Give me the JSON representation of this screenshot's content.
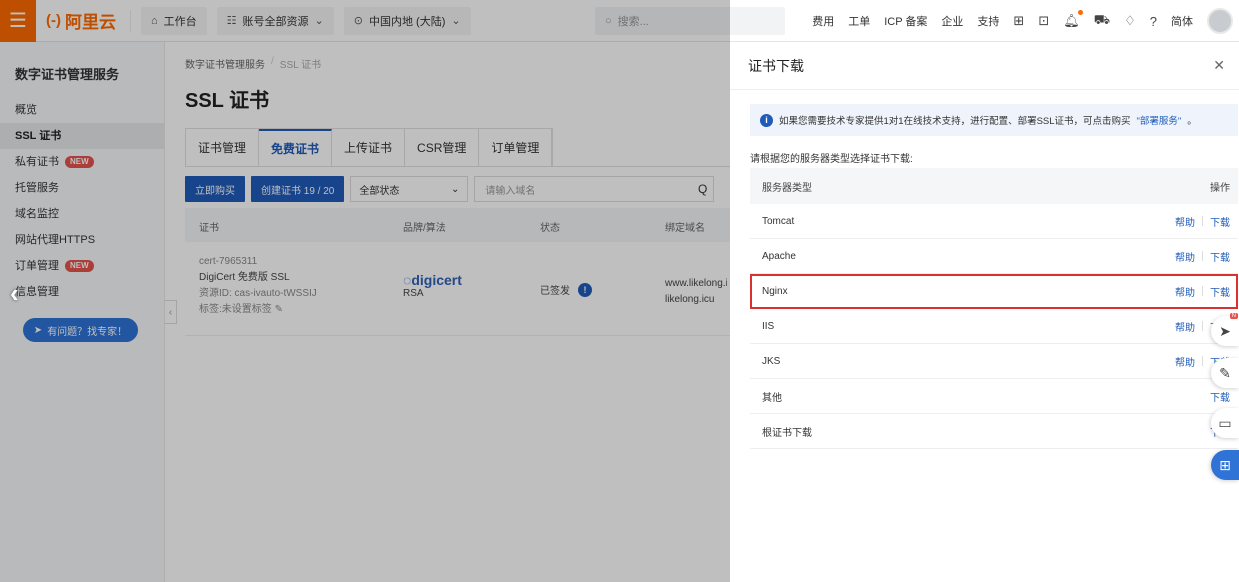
{
  "topbar": {
    "menu_icon": "hamburger-icon",
    "logo_text": "阿里云",
    "nav": [
      {
        "icon": "home-icon",
        "label": "工作台"
      },
      {
        "icon": "list-icon",
        "label": "账号全部资源"
      },
      {
        "icon": "location-icon",
        "label": "中国内地 (大陆)"
      }
    ],
    "search_placeholder": "搜索...",
    "links": [
      "费用",
      "工单",
      "ICP 备案",
      "企业",
      "支持"
    ],
    "lang": "简体"
  },
  "sidebar": {
    "title": "数字证书管理服务",
    "items": [
      {
        "label": "概览",
        "active": false,
        "badge": ""
      },
      {
        "label": "SSL 证书",
        "active": true,
        "badge": ""
      },
      {
        "label": "私有证书",
        "active": false,
        "badge": "NEW"
      },
      {
        "label": "托管服务",
        "active": false,
        "badge": ""
      },
      {
        "label": "域名监控",
        "active": false,
        "badge": ""
      },
      {
        "label": "网站代理HTTPS",
        "active": false,
        "badge": ""
      },
      {
        "label": "订单管理",
        "active": false,
        "badge": "NEW"
      },
      {
        "label": "信息管理",
        "active": false,
        "badge": ""
      }
    ],
    "expert_button": "有问题？找专家！"
  },
  "main": {
    "breadcrumb": [
      "数字证书管理服务",
      "SSL 证书"
    ],
    "title": "SSL 证书",
    "tabs": [
      "证书管理",
      "免费证书",
      "上传证书",
      "CSR管理",
      "订单管理"
    ],
    "active_tab": 1,
    "buy_button": "立即购买",
    "create_button": "创建证书 19 / 20",
    "status_select": "全部状态",
    "domain_input_placeholder": "请输入域名",
    "table_headers": [
      "证书",
      "品牌/算法",
      "状态",
      "绑定域名"
    ],
    "row": {
      "cert_id": "cert-7965311",
      "cert_name": "DigiCert 免费版 SSL",
      "resource_id": "资源ID: cas-ivauto-tWSSIJ",
      "tag": "标签:未设置标签",
      "brand": "digicert",
      "algorithm": "RSA",
      "status": "已签发",
      "domain1": "www.likelong.i",
      "domain2": "likelong.icu"
    }
  },
  "drawer": {
    "title": "证书下载",
    "notice_text": "如果您需要技术专家提供1对1在线技术支持，进行配置、部署SSL证书，可点击购买",
    "notice_link": "\"部署服务\"",
    "notice_end": "。",
    "instruction": "请根据您的服务器类型选择证书下载:",
    "col_server": "服务器类型",
    "col_ops": "操作",
    "help_label": "帮助",
    "download_label": "下载",
    "rows": [
      {
        "name": "Tomcat",
        "help": true
      },
      {
        "name": "Apache",
        "help": true
      },
      {
        "name": "Nginx",
        "help": true,
        "highlighted": true
      },
      {
        "name": "IIS",
        "help": true
      },
      {
        "name": "JKS",
        "help": true
      },
      {
        "name": "其他",
        "help": false
      },
      {
        "name": "根证书下载",
        "help": false
      }
    ]
  },
  "colors": {
    "brand_orange": "#ff6a00",
    "primary_blue": "#1f5bb8",
    "highlight_red": "#d93030"
  }
}
